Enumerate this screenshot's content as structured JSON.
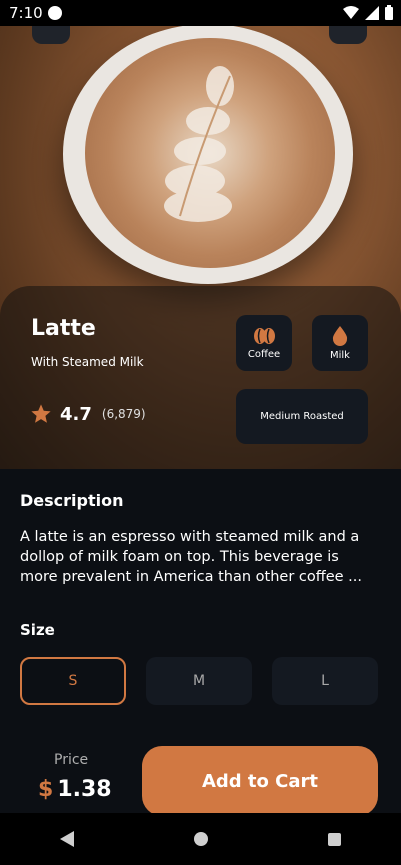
{
  "status_bar": {
    "time": "7:10",
    "icons": [
      "app-icon",
      "wifi-icon",
      "signal-icon",
      "battery-icon"
    ]
  },
  "product": {
    "name": "Latte",
    "subtitle": "With Steamed Milk",
    "rating": "4.7",
    "rating_count": "(6,879)",
    "chips": {
      "coffee": "Coffee",
      "milk": "Milk",
      "roast": "Medium Roasted"
    }
  },
  "description": {
    "title": "Description",
    "text": "A latte is an espresso with steamed milk and a dollop of milk foam on top. This beverage is more prevalent in America than other coffee ..."
  },
  "size": {
    "title": "Size",
    "options": [
      "S",
      "M",
      "L"
    ],
    "selected": "S"
  },
  "footer": {
    "price_label": "Price",
    "currency": "$",
    "price": "1.38",
    "cart_label": "Add to Cart"
  },
  "colors": {
    "accent": "#d17842",
    "background": "#0c0f14",
    "card": "#141921"
  }
}
